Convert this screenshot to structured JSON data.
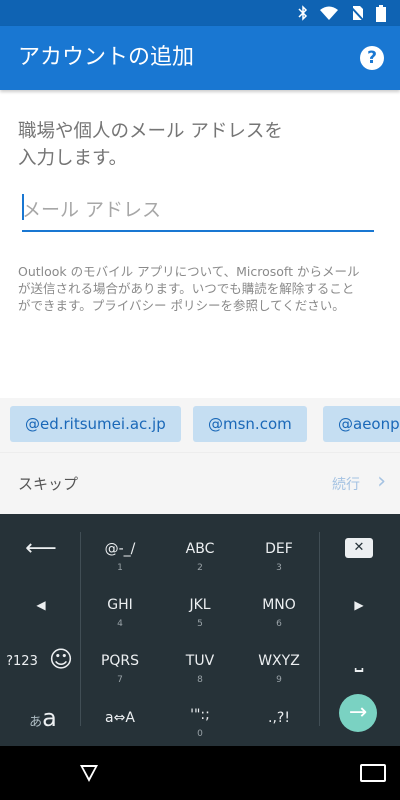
{
  "header": {
    "title": "アカウントの追加",
    "help_glyph": "?"
  },
  "form": {
    "prompt_line1": "職場や個人のメール アドレスを",
    "prompt_line2": "入力します。",
    "email_placeholder": "メール アドレス",
    "notice_line1": "Outlook のモバイル アプリについて、Microsoft からメール",
    "notice_line2": "が送信される場合があります。いつでも購読を解除すること",
    "notice_line3": "ができます。プライバシー ポリシーを参照してください。"
  },
  "domains": [
    "@ed.ritsumei.ac.jp",
    "@msn.com",
    "@aeonp"
  ],
  "actions": {
    "skip": "スキップ",
    "next": "続行"
  },
  "keyboard": {
    "keys": [
      {
        "label": "@-_/",
        "number": "1"
      },
      {
        "label": "ABC",
        "number": "2"
      },
      {
        "label": "DEF",
        "number": "3"
      },
      {
        "label": "GHI",
        "number": "4"
      },
      {
        "label": "JKL",
        "number": "5"
      },
      {
        "label": "MNO",
        "number": "6"
      },
      {
        "label": "PQRS",
        "number": "7"
      },
      {
        "label": "TUV",
        "number": "8"
      },
      {
        "label": "WXYZ",
        "number": "9"
      },
      {
        "label": "a⇔A",
        "number": ""
      },
      {
        "label": "'\":;",
        "number": "0"
      },
      {
        "label": ".,?!",
        "number": ""
      }
    ],
    "mode_123": "?123",
    "mode_kana": "あ",
    "mode_alpha": "a",
    "cursor_left": "◀",
    "cursor_right": "▶",
    "backspace_glyph": "✕",
    "back_arrow_glyph": "⟵",
    "emoji_glyph": "☺",
    "space_glyph": "⎵",
    "enter_glyph": "→"
  },
  "colors": {
    "statusbar": "#0f63b3",
    "appbar": "#1977d2",
    "chip_bg": "#c5def2",
    "keyboard_bg": "#263238",
    "enter": "#7ad2c2"
  }
}
